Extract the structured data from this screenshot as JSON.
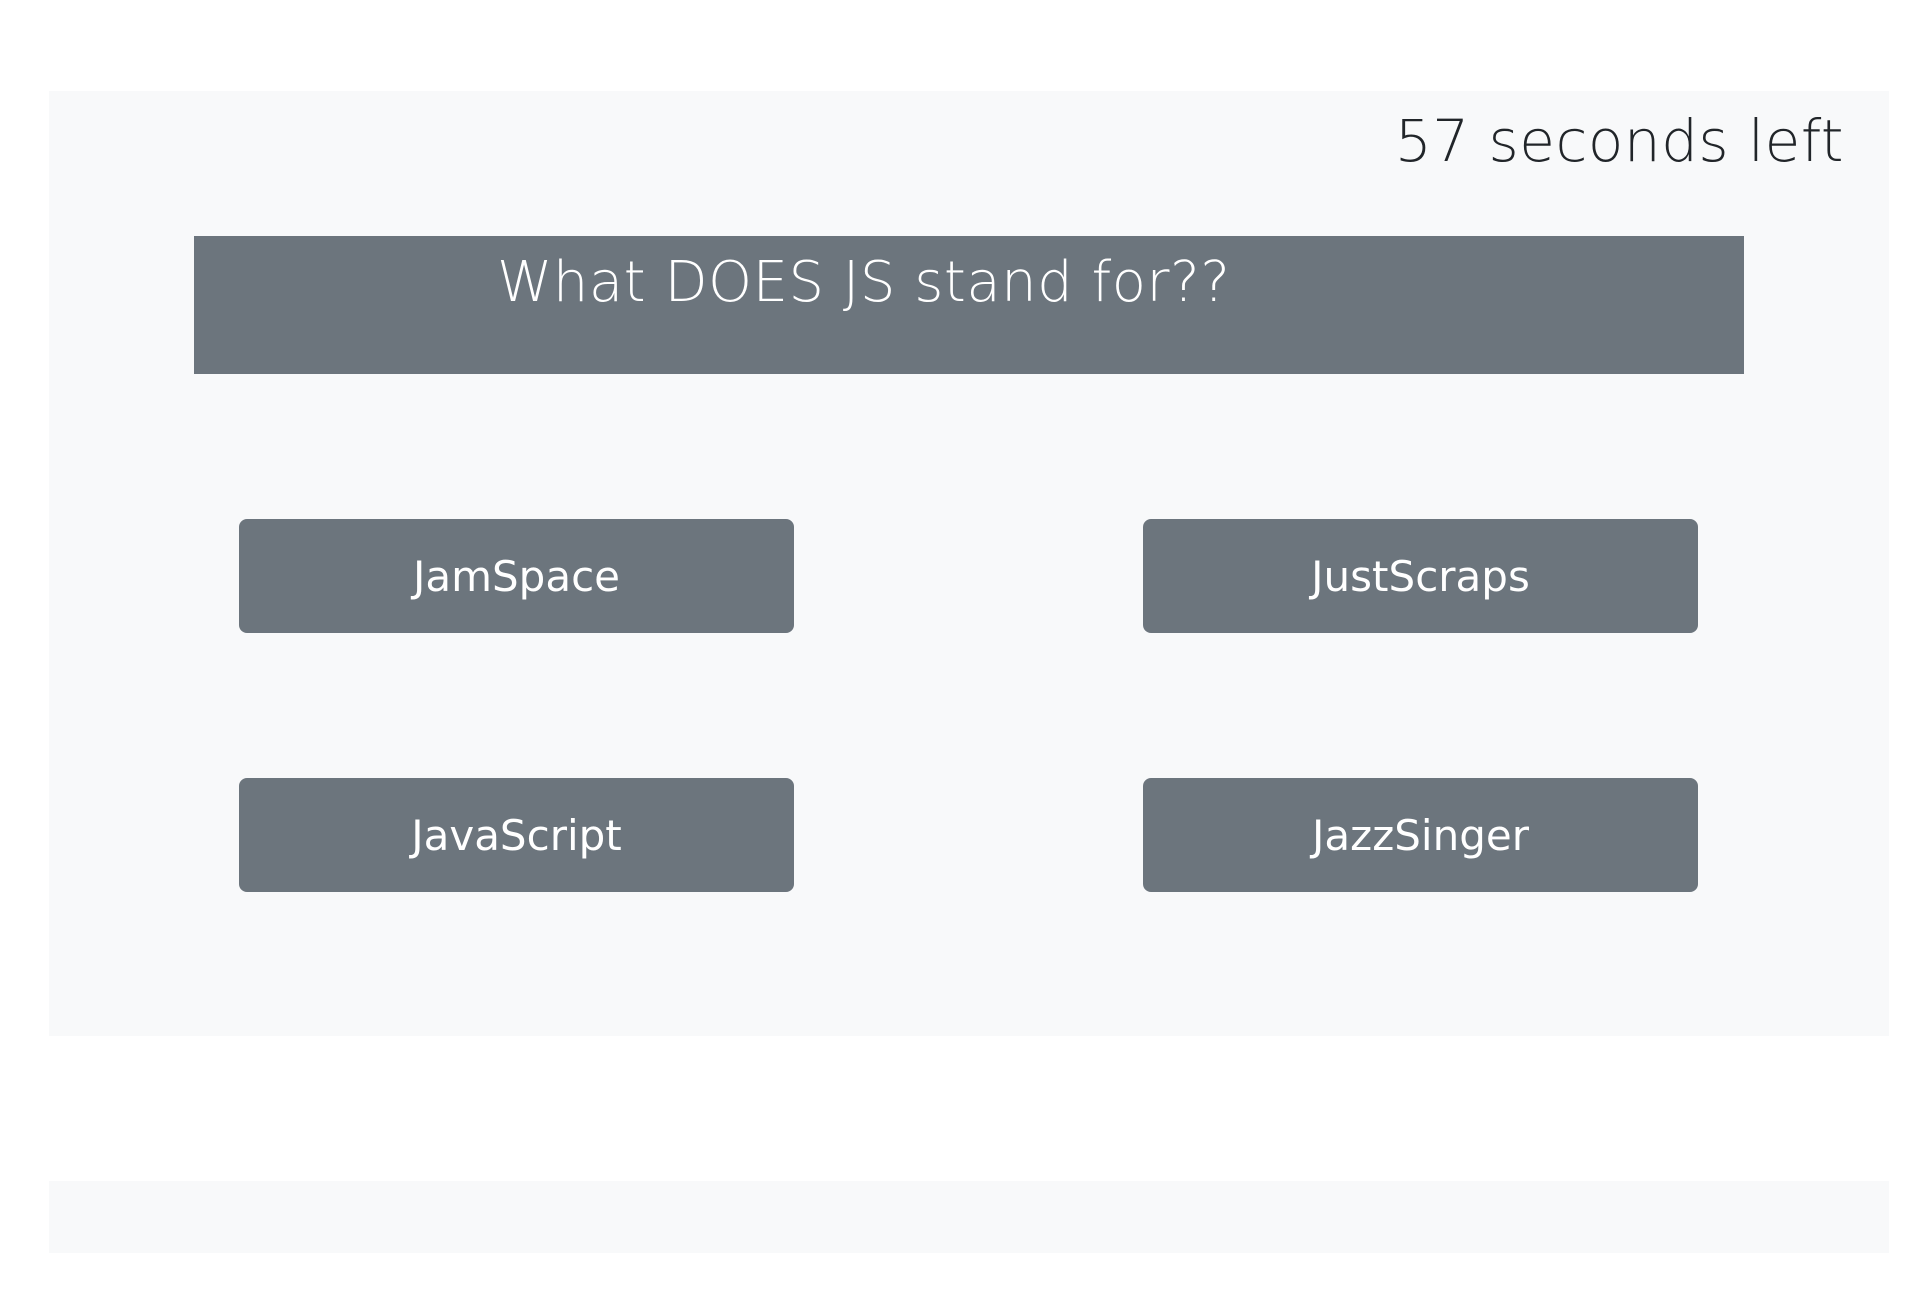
{
  "timer": {
    "text": "57 seconds left"
  },
  "question": {
    "text": "What DOES JS stand for??"
  },
  "answers": [
    {
      "label": "JamSpace"
    },
    {
      "label": "JustScraps"
    },
    {
      "label": "JavaScript"
    },
    {
      "label": "JazzSinger"
    }
  ],
  "colors": {
    "card_background": "#f8f9fa",
    "button_background": "#6c757d",
    "button_text": "#ffffff",
    "timer_text": "#212529"
  }
}
